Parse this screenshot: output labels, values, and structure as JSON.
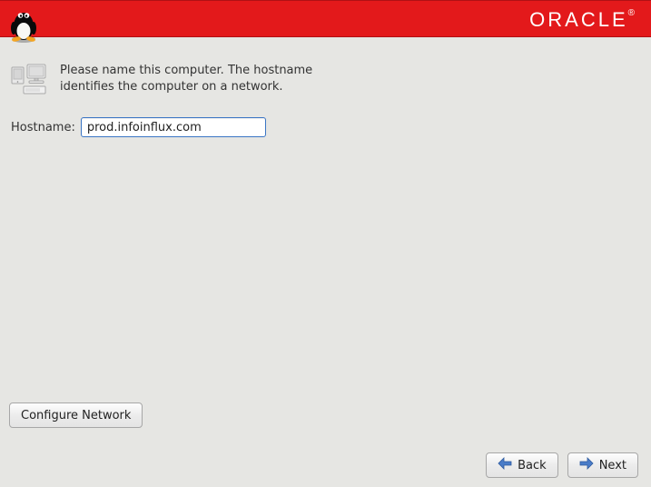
{
  "brand": "ORACLE",
  "intro": "Please name this computer.  The hostname identifies the computer on a network.",
  "hostname_label": "Hostname:",
  "hostname_value": "prod.infoinflux.com",
  "buttons": {
    "configure_network": "Configure Network",
    "back": "Back",
    "next": "Next"
  }
}
